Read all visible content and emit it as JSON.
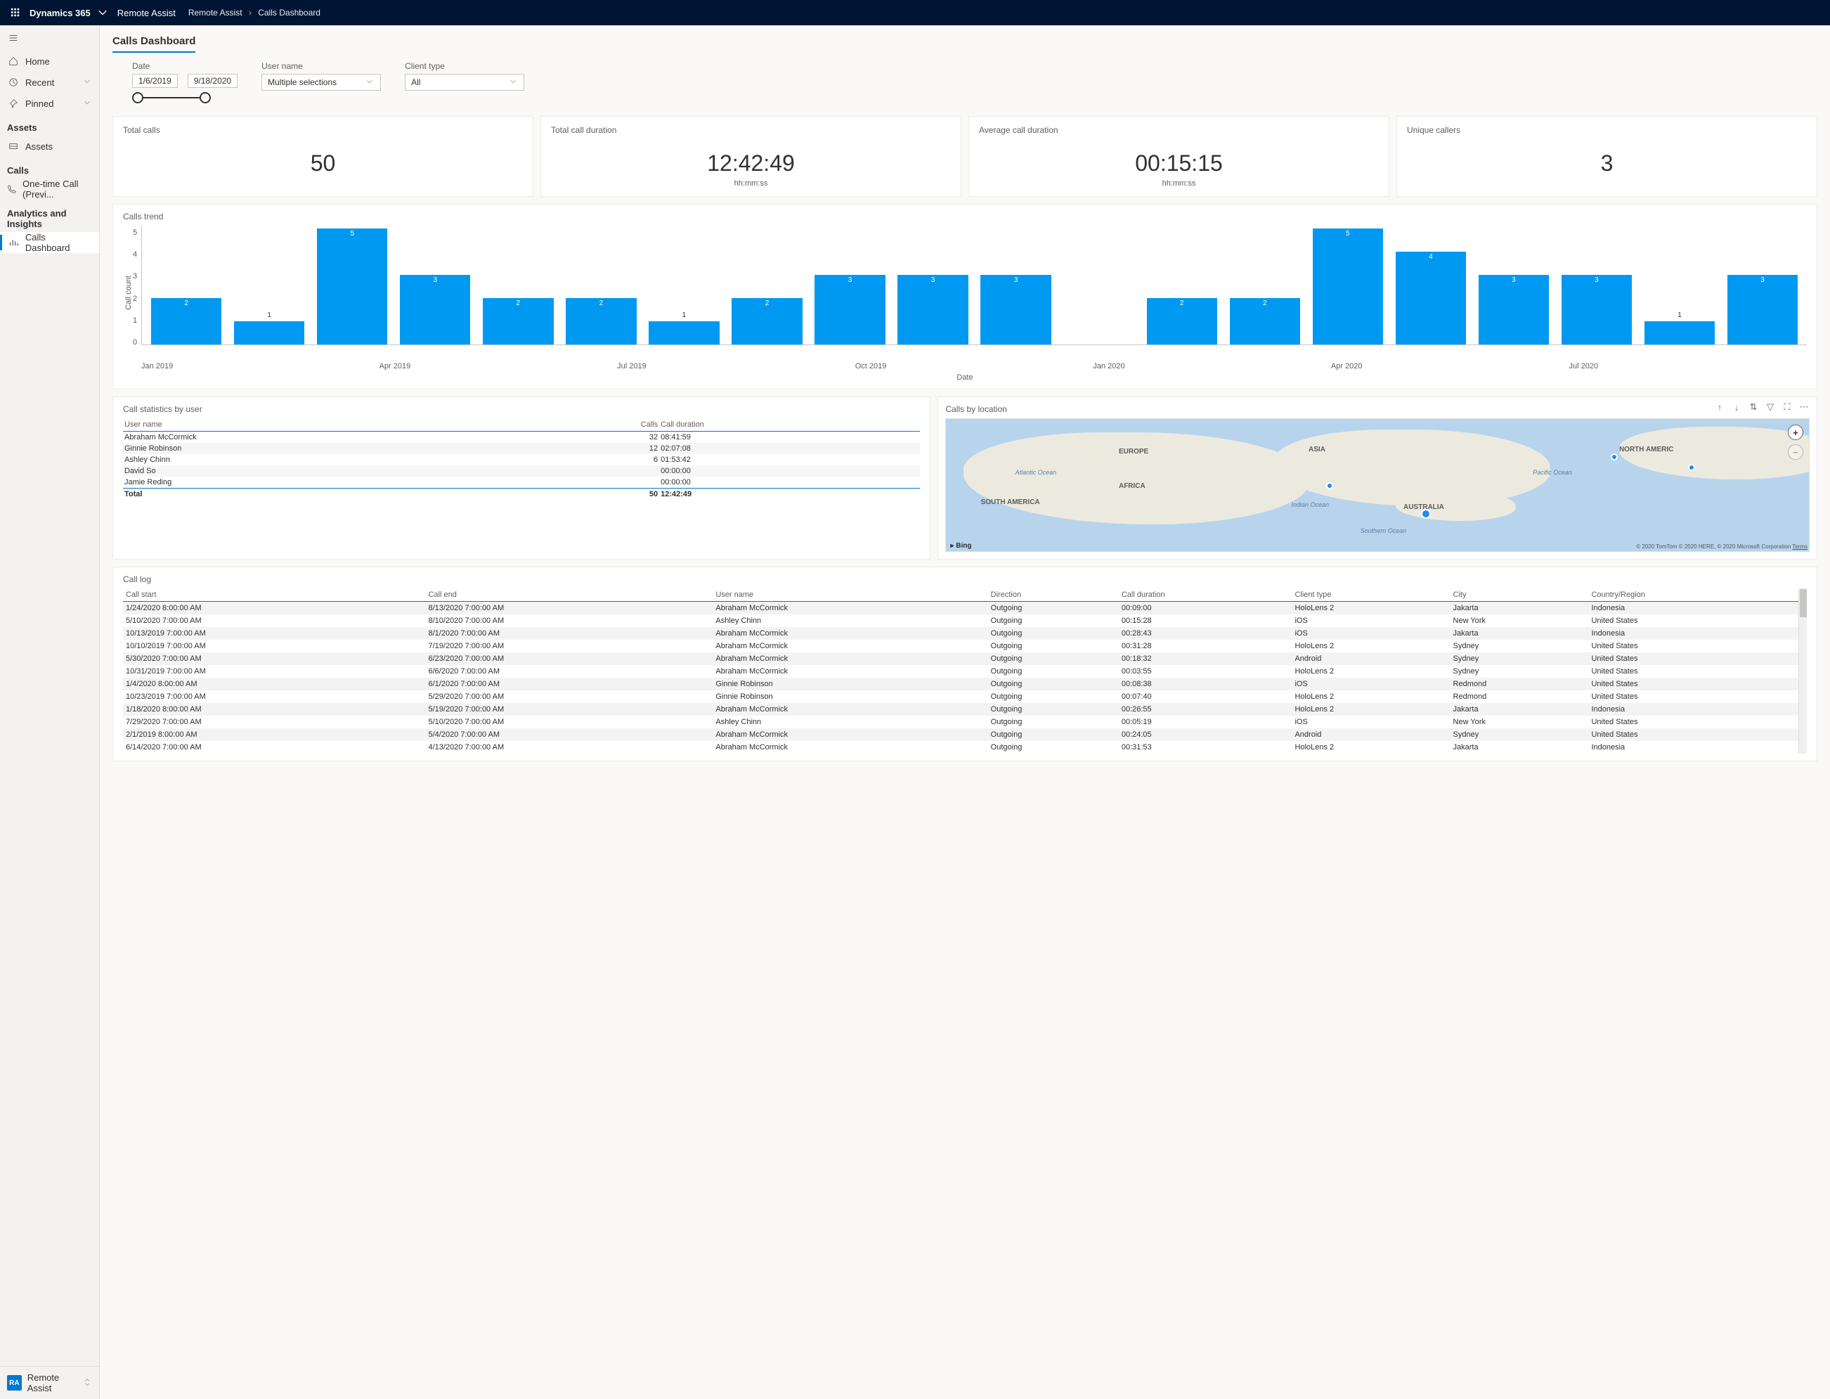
{
  "topbar": {
    "brand": "Dynamics 365",
    "app": "Remote Assist",
    "breadcrumb": [
      "Remote Assist",
      "Calls Dashboard"
    ]
  },
  "sidebar": {
    "items": [
      {
        "label": "Home",
        "icon": "home-icon"
      },
      {
        "label": "Recent",
        "icon": "clock-icon",
        "caret": true
      },
      {
        "label": "Pinned",
        "icon": "pin-icon",
        "caret": true
      }
    ],
    "groups": [
      {
        "label": "Assets",
        "items": [
          {
            "label": "Assets",
            "icon": "assets-icon"
          }
        ]
      },
      {
        "label": "Calls",
        "items": [
          {
            "label": "One-time Call (Previ...",
            "icon": "phone-icon"
          }
        ]
      },
      {
        "label": "Analytics and Insights",
        "items": [
          {
            "label": "Calls Dashboard",
            "icon": "chart-icon",
            "active": true
          }
        ]
      }
    ],
    "footer": {
      "badge": "RA",
      "label": "Remote Assist"
    }
  },
  "page": {
    "title": "Calls Dashboard"
  },
  "filters": {
    "date": {
      "label": "Date",
      "from": "1/6/2019",
      "to": "9/18/2020"
    },
    "user": {
      "label": "User name",
      "value": "Multiple selections"
    },
    "client": {
      "label": "Client type",
      "value": "All"
    }
  },
  "cards": {
    "total_calls": {
      "title": "Total calls",
      "value": "50"
    },
    "total_duration": {
      "title": "Total call duration",
      "value": "12:42:49",
      "sub": "hh:mm:ss"
    },
    "avg_duration": {
      "title": "Average call duration",
      "value": "00:15:15",
      "sub": "hh:mm:ss"
    },
    "unique_callers": {
      "title": "Unique callers",
      "value": "3"
    }
  },
  "chart_data": {
    "type": "bar",
    "title": "Calls trend",
    "ylabel": "Call count",
    "xlabel": "Date",
    "ylim": [
      0,
      5
    ],
    "yticks": [
      0,
      1,
      2,
      3,
      4,
      5
    ],
    "xticks": [
      "Jan 2019",
      "Apr 2019",
      "Jul 2019",
      "Oct 2019",
      "Jan 2020",
      "Apr 2020",
      "Jul 2020"
    ],
    "categories": [
      "Jan 2019",
      "Feb 2019",
      "Mar 2019",
      "Apr 2019",
      "May 2019",
      "Jun 2019",
      "Jul 2019",
      "Aug 2019",
      "Sep 2019",
      "Oct 2019",
      "Nov 2019",
      "Dec 2019",
      "Jan 2020",
      "Feb 2020",
      "Mar 2020",
      "Apr 2020",
      "May 2020",
      "Jun 2020",
      "Jul 2020",
      "Aug 2020"
    ],
    "values": [
      2,
      1,
      5,
      3,
      2,
      2,
      1,
      2,
      3,
      3,
      3,
      0,
      2,
      2,
      5,
      4,
      3,
      3,
      1,
      3
    ]
  },
  "stats": {
    "title": "Call statistics by user",
    "headers": [
      "User name",
      "Calls",
      "Call duration"
    ],
    "rows": [
      {
        "name": "Abraham McCormick",
        "calls": "32",
        "duration": "08:41:59"
      },
      {
        "name": "Ginnie Robinson",
        "calls": "12",
        "duration": "02:07:08"
      },
      {
        "name": "Ashley Chinn",
        "calls": "6",
        "duration": "01:53:42"
      },
      {
        "name": "David So",
        "calls": "",
        "duration": "00:00:00"
      },
      {
        "name": "Jamie Reding",
        "calls": "",
        "duration": "00:00:00"
      }
    ],
    "total": {
      "label": "Total",
      "calls": "50",
      "duration": "12:42:49"
    }
  },
  "map": {
    "title": "Calls by location",
    "continents": [
      "EUROPE",
      "ASIA",
      "NORTH AMERIC",
      "AFRICA",
      "SOUTH AMERICA",
      "AUSTRALIA"
    ],
    "oceans": [
      "Atlantic Ocean",
      "Pacific Ocean",
      "Indian Ocean",
      "Southern Ocean"
    ],
    "provider": "Bing",
    "attrib": "© 2020 TomTom © 2020 HERE, © 2020 Microsoft Corporation",
    "terms": "Terms"
  },
  "log": {
    "title": "Call log",
    "headers": [
      "Call start",
      "Call end",
      "User name",
      "Direction",
      "Call duration",
      "Client type",
      "City",
      "Country/Region"
    ],
    "rows": [
      {
        "start": "1/24/2020 8:00:00 AM",
        "end": "8/13/2020 7:00:00 AM",
        "user": "Abraham McCormick",
        "dir": "Outgoing",
        "dur": "00:09:00",
        "client": "HoloLens 2",
        "city": "Jakarta",
        "country": "Indonesia"
      },
      {
        "start": "5/10/2020 7:00:00 AM",
        "end": "8/10/2020 7:00:00 AM",
        "user": "Ashley Chinn",
        "dir": "Outgoing",
        "dur": "00:15:28",
        "client": "iOS",
        "city": "New York",
        "country": "United States"
      },
      {
        "start": "10/13/2019 7:00:00 AM",
        "end": "8/1/2020 7:00:00 AM",
        "user": "Abraham McCormick",
        "dir": "Outgoing",
        "dur": "00:28:43",
        "client": "iOS",
        "city": "Jakarta",
        "country": "Indonesia"
      },
      {
        "start": "10/10/2019 7:00:00 AM",
        "end": "7/19/2020 7:00:00 AM",
        "user": "Abraham McCormick",
        "dir": "Outgoing",
        "dur": "00:31:28",
        "client": "HoloLens 2",
        "city": "Sydney",
        "country": "United States"
      },
      {
        "start": "5/30/2020 7:00:00 AM",
        "end": "6/23/2020 7:00:00 AM",
        "user": "Abraham McCormick",
        "dir": "Outgoing",
        "dur": "00:18:32",
        "client": "Android",
        "city": "Sydney",
        "country": "United States"
      },
      {
        "start": "10/31/2019 7:00:00 AM",
        "end": "6/6/2020 7:00:00 AM",
        "user": "Abraham McCormick",
        "dir": "Outgoing",
        "dur": "00:03:55",
        "client": "HoloLens 2",
        "city": "Sydney",
        "country": "United States"
      },
      {
        "start": "1/4/2020 8:00:00 AM",
        "end": "6/1/2020 7:00:00 AM",
        "user": "Ginnie Robinson",
        "dir": "Outgoing",
        "dur": "00:08:38",
        "client": "iOS",
        "city": "Redmond",
        "country": "United States"
      },
      {
        "start": "10/23/2019 7:00:00 AM",
        "end": "5/29/2020 7:00:00 AM",
        "user": "Ginnie Robinson",
        "dir": "Outgoing",
        "dur": "00:07:40",
        "client": "HoloLens 2",
        "city": "Redmond",
        "country": "United States"
      },
      {
        "start": "1/18/2020 8:00:00 AM",
        "end": "5/19/2020 7:00:00 AM",
        "user": "Abraham McCormick",
        "dir": "Outgoing",
        "dur": "00:26:55",
        "client": "HoloLens 2",
        "city": "Jakarta",
        "country": "Indonesia"
      },
      {
        "start": "7/29/2020 7:00:00 AM",
        "end": "5/10/2020 7:00:00 AM",
        "user": "Ashley Chinn",
        "dir": "Outgoing",
        "dur": "00:05:19",
        "client": "iOS",
        "city": "New York",
        "country": "United States"
      },
      {
        "start": "2/1/2019 8:00:00 AM",
        "end": "5/4/2020 7:00:00 AM",
        "user": "Abraham McCormick",
        "dir": "Outgoing",
        "dur": "00:24:05",
        "client": "Android",
        "city": "Sydney",
        "country": "United States"
      },
      {
        "start": "6/14/2020 7:00:00 AM",
        "end": "4/13/2020 7:00:00 AM",
        "user": "Abraham McCormick",
        "dir": "Outgoing",
        "dur": "00:31:53",
        "client": "HoloLens 2",
        "city": "Jakarta",
        "country": "Indonesia"
      }
    ]
  }
}
